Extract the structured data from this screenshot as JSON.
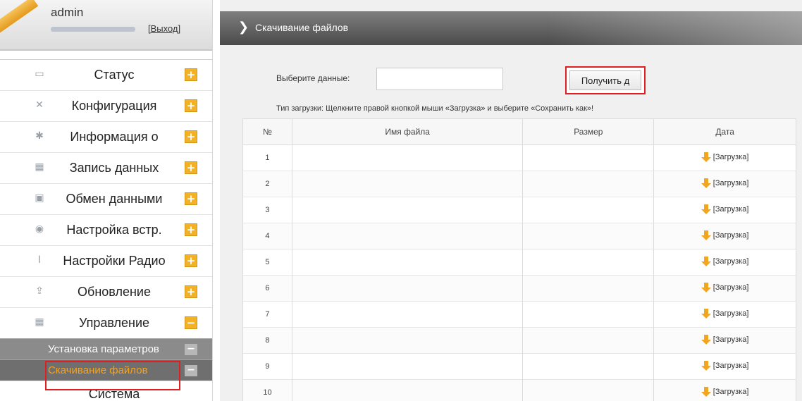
{
  "user": {
    "name": "admin",
    "logout_label": "[Выход]"
  },
  "sidebar": {
    "items": [
      {
        "label": "Статус",
        "icon": "monitor-icon",
        "toggle": "+"
      },
      {
        "label": "Конфигурация",
        "icon": "tools-icon",
        "toggle": "+"
      },
      {
        "label": "Информация о",
        "icon": "info-icon",
        "toggle": "+"
      },
      {
        "label": "Запись данных",
        "icon": "calendar-icon",
        "toggle": "+"
      },
      {
        "label": "Обмен данными",
        "icon": "network-icon",
        "toggle": "+"
      },
      {
        "label": "Настройка встр.",
        "icon": "settings-icon",
        "toggle": "+"
      },
      {
        "label": "Настройки Радио",
        "icon": "antenna-icon",
        "toggle": "+"
      },
      {
        "label": "Обновление",
        "icon": "upload-icon",
        "toggle": "+"
      },
      {
        "label": "Управление",
        "icon": "calendar-icon",
        "toggle": "−"
      }
    ],
    "submenu": [
      {
        "label": "Установка параметров",
        "toggle": "−"
      },
      {
        "label": "Скачивание файлов",
        "toggle": "−"
      }
    ],
    "next_item": {
      "label": "Система"
    }
  },
  "main": {
    "page_title": "Скачивание файлов",
    "data_label": "Выберите данные:",
    "data_input_value": "",
    "get_button_label": "Получить д",
    "download_hint": "Тип загрузки:  Щелкните правой кнопкой мыши «Загрузка» и выберите «Сохранить как»!",
    "table": {
      "headers": [
        "№",
        "Имя файла",
        "Размер",
        "Дата"
      ],
      "download_label": "[Загрузка]",
      "rows": [
        {
          "num": "1",
          "name": "",
          "size": ""
        },
        {
          "num": "2",
          "name": "",
          "size": ""
        },
        {
          "num": "3",
          "name": "",
          "size": ""
        },
        {
          "num": "4",
          "name": "",
          "size": ""
        },
        {
          "num": "5",
          "name": "",
          "size": ""
        },
        {
          "num": "6",
          "name": "",
          "size": ""
        },
        {
          "num": "7",
          "name": "",
          "size": ""
        },
        {
          "num": "8",
          "name": "",
          "size": ""
        },
        {
          "num": "9",
          "name": "",
          "size": ""
        },
        {
          "num": "10",
          "name": "",
          "size": ""
        }
      ]
    }
  },
  "colors": {
    "accent": "#f3b125",
    "highlight": "#e02020",
    "active_submenu_text": "#f7a21b"
  }
}
